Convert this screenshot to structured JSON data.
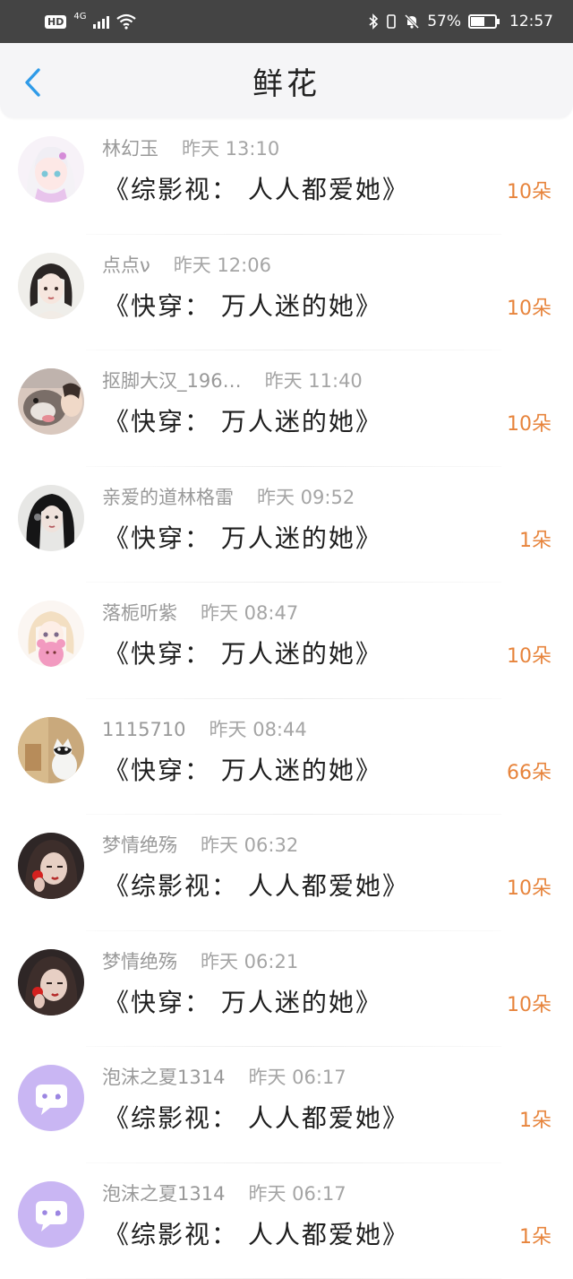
{
  "status_bar": {
    "hd": "HD",
    "network": "4G",
    "battery_text": "57%",
    "battery_level": 0.57,
    "time": "12:57"
  },
  "header": {
    "title": "鲜花"
  },
  "colors": {
    "accent_orange": "#e7843c",
    "back_blue": "#2f9be8"
  },
  "items": [
    {
      "name": "林幻玉",
      "time": "昨天 13:10",
      "book": "《综影视： 人人都爱她》",
      "count": "10朵",
      "avatar": "anime-girl-white-hair"
    },
    {
      "name": "点点ν",
      "time": "昨天 12:06",
      "book": "《快穿： 万人迷的她》",
      "count": "10朵",
      "avatar": "illustrated-girl"
    },
    {
      "name": "抠脚大汉_196…",
      "time": "昨天 11:40",
      "book": "《快穿： 万人迷的她》",
      "count": "10朵",
      "avatar": "dog-photo"
    },
    {
      "name": "亲爱的道林格雷",
      "time": "昨天 09:52",
      "book": "《快穿： 万人迷的她》",
      "count": "1朵",
      "avatar": "dark-hair-girl"
    },
    {
      "name": "落栀听紫",
      "time": "昨天 08:47",
      "book": "《快穿： 万人迷的她》",
      "count": "10朵",
      "avatar": "anime-girl-pink-bear"
    },
    {
      "name": "1115710",
      "time": "昨天 08:44",
      "book": "《快穿： 万人迷的她》",
      "count": "66朵",
      "avatar": "cat-photo"
    },
    {
      "name": "梦情绝殇",
      "time": "昨天 06:32",
      "book": "《综影视： 人人都爱她》",
      "count": "10朵",
      "avatar": "girl-with-strawberry"
    },
    {
      "name": "梦情绝殇",
      "time": "昨天 06:21",
      "book": "《快穿： 万人迷的她》",
      "count": "10朵",
      "avatar": "girl-with-strawberry"
    },
    {
      "name": "泡沫之夏1314",
      "time": "昨天 06:17",
      "book": "《综影视： 人人都爱她》",
      "count": "1朵",
      "avatar": "default-chat-avatar"
    },
    {
      "name": "泡沫之夏1314",
      "time": "昨天 06:17",
      "book": "《综影视： 人人都爱她》",
      "count": "1朵",
      "avatar": "default-chat-avatar"
    }
  ]
}
